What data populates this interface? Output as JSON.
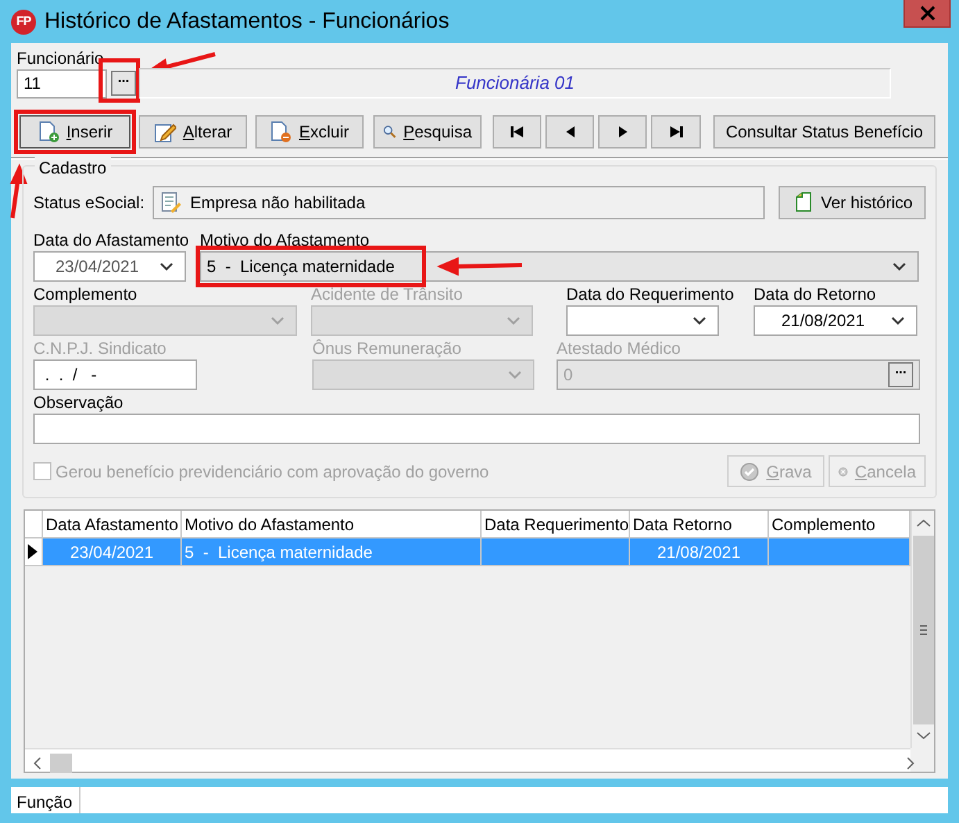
{
  "window": {
    "app_icon_text": "FP",
    "title": "Histórico de Afastamentos - Funcionários"
  },
  "funcionario": {
    "label": "Funcionário",
    "code": "11",
    "name": "Funcionária 01",
    "lookup_button": {
      "label": "...",
      "highlighted": true
    }
  },
  "toolbar": [
    {
      "kind": "insert",
      "label": "Inserir",
      "underline_first": true,
      "highlighted": true
    },
    {
      "kind": "edit",
      "label": "Alterar",
      "underline_first": true,
      "highlighted": false
    },
    {
      "kind": "delete",
      "label": "Excluir",
      "underline_first": true,
      "highlighted": false
    },
    {
      "kind": "search",
      "label": "Pesquisa",
      "underline_first": true,
      "highlighted": false
    },
    {
      "kind": "first",
      "highlighted": false
    },
    {
      "kind": "prev",
      "highlighted": false
    },
    {
      "kind": "next",
      "highlighted": false
    },
    {
      "kind": "last",
      "highlighted": false
    },
    {
      "kind": "text",
      "label": "Consultar Status Benefício",
      "underline_first": false,
      "highlighted": false
    }
  ],
  "cadastro": {
    "title": "Cadastro",
    "status_label": "Status eSocial:",
    "status_value": "Empresa não habilitada",
    "history_button": "Ver histórico",
    "field_rows": [
      [
        {
          "label": "Data do Afastamento",
          "kind": "combo",
          "value": "23/04/2021",
          "disabled": false,
          "readonly": false,
          "highlighted": false
        },
        {
          "label": "Motivo do Afastamento",
          "kind": "combo",
          "value": "5  -  Licença maternidade",
          "disabled": false,
          "readonly": true,
          "highlighted": true
        }
      ],
      [
        {
          "label": "Complemento",
          "kind": "combo",
          "disabled": true,
          "readonly": false,
          "label_disabled": false,
          "highlighted": false
        },
        {
          "label": "Acidente de Trânsito",
          "kind": "combo",
          "disabled": true,
          "readonly": false,
          "label_disabled": true,
          "highlighted": false
        },
        {
          "label": "Data do Requerimento",
          "kind": "combo",
          "disabled": false,
          "readonly": false,
          "label_disabled": false,
          "highlighted": false
        },
        {
          "label": "Data do Retorno",
          "kind": "combo",
          "value": "21/08/2021",
          "disabled": false,
          "readonly": false,
          "label_disabled": false,
          "highlighted": false
        }
      ],
      [
        {
          "label": "C.N.P.J. Sindicato",
          "kind": "text",
          "value": " .  .  /   -",
          "disabled": false,
          "readonly": false,
          "label_disabled": true,
          "highlighted": false
        },
        {
          "label": "Ônus Remuneração",
          "kind": "combo",
          "disabled": true,
          "readonly": false,
          "label_disabled": true,
          "highlighted": false
        },
        {
          "label": "Atestado Médico",
          "kind": "lookup",
          "value": "0",
          "button": "...",
          "disabled": false,
          "readonly": true,
          "label_disabled": true,
          "highlighted": false
        }
      ]
    ],
    "observacao": {
      "label": "Observação"
    },
    "checkbox": {
      "label": "Gerou benefício previdenciário com aprovação do governo",
      "checked": false,
      "disabled": true
    },
    "actions": [
      {
        "kind": "save",
        "label": "Grava",
        "disabled": true
      },
      {
        "kind": "cancel",
        "label": "Cancela",
        "disabled": true
      }
    ]
  },
  "grid": {
    "columns": [
      "Data Afastamento",
      "Motivo do Afastamento",
      "Data Requerimento",
      "Data Retorno",
      "Complemento"
    ],
    "rows": [
      {
        "current": true,
        "selected": true,
        "cells": [
          "23/04/2021",
          "5  -  Licença maternidade",
          null,
          "21/08/2021",
          null
        ]
      }
    ]
  },
  "status_bar": [
    "Função"
  ]
}
